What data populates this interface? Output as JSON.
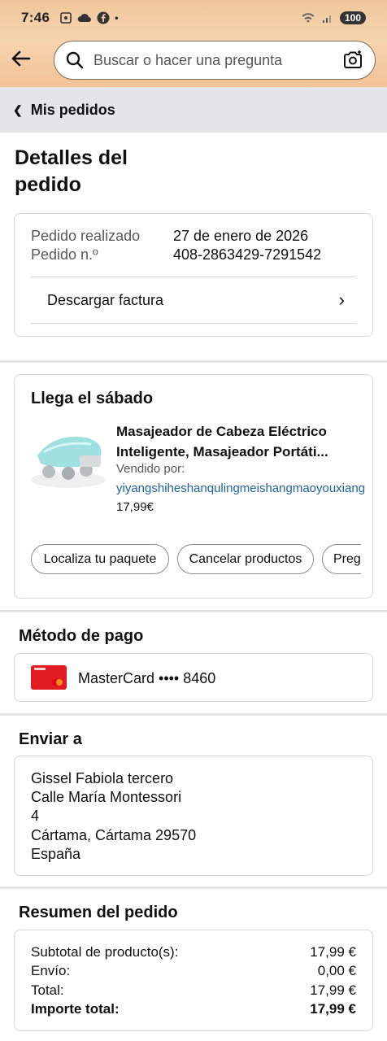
{
  "status_bar": {
    "time": "7:46",
    "battery": "100"
  },
  "search": {
    "placeholder": "Buscar o hacer una pregunta"
  },
  "breadcrumb": {
    "label": "Mis pedidos"
  },
  "page_title": "Detalles del pedido",
  "order_info": {
    "placed_label": "Pedido realizado",
    "placed_value": "27 de enero de 2026",
    "number_label": "Pedido n.º",
    "number_value": "408-2863429-7291542",
    "invoice_label": "Descargar factura"
  },
  "shipment": {
    "heading": "Llega el sábado",
    "product_title_line1": "Masajeador de Cabeza Eléctrico",
    "product_title_line2": "Inteligente, Masajeador Portáti...",
    "sold_by_label": "Vendido por:",
    "seller": "yiyangshiheshanqulingmeishangmaoyouxiang",
    "price": "17,99€",
    "buttons": [
      "Localiza tu paquete",
      "Cancelar productos",
      "Preg"
    ]
  },
  "payment": {
    "heading": "Método de pago",
    "card_text": "MasterCard •••• 8460"
  },
  "shipping": {
    "heading": "Enviar a",
    "lines": [
      "Gissel Fabiola tercero",
      "Calle María Montessori",
      "4",
      "Cártama, Cártama 29570",
      "España"
    ]
  },
  "summary": {
    "heading": "Resumen del pedido",
    "rows": [
      {
        "label": "Subtotal de producto(s):",
        "value": "17,99 €"
      },
      {
        "label": "Envío:",
        "value": "0,00 €"
      },
      {
        "label": "Total:",
        "value": "17,99 €"
      },
      {
        "label": "Importe total:",
        "value": "17,99 €"
      }
    ]
  },
  "colors": {
    "header_orange": "#f0c69a",
    "link_blue": "#2162a1",
    "divider": "#e3e6e6"
  }
}
